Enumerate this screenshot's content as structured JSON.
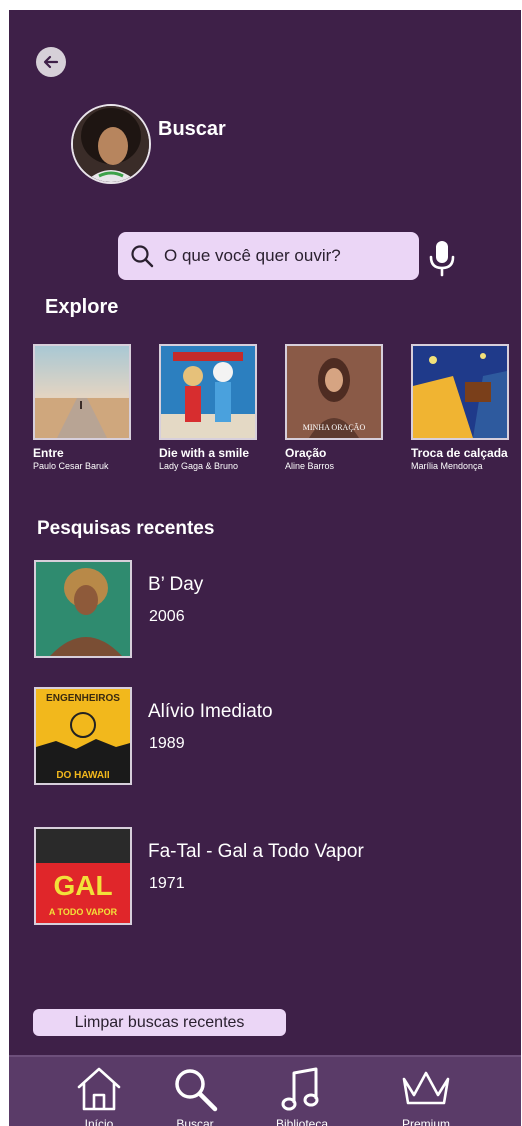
{
  "header": {
    "title": "Buscar"
  },
  "search": {
    "placeholder": "O que você quer ouvir?"
  },
  "explore": {
    "title": "Explore",
    "items": [
      {
        "title": "Entre",
        "artist": "Paulo Cesar Baruk"
      },
      {
        "title": "Die with a smile",
        "artist": "Lady Gaga & Bruno"
      },
      {
        "title": "Oração",
        "artist": "Aline Barros"
      },
      {
        "title": "Troca de calçada",
        "artist": "Marília Mendonça"
      }
    ]
  },
  "recent": {
    "title": "Pesquisas recentes",
    "items": [
      {
        "title": "B’ Day",
        "year": "2006"
      },
      {
        "title": "Alívio Imediato",
        "year": "1989"
      },
      {
        "title": "Fa-Tal - Gal a Todo Vapor",
        "year": "1971"
      }
    ],
    "clear_label": "Limpar buscas recentes"
  },
  "cover_texts": {
    "oracao": "MINHA ORAÇÃO",
    "engenheiros_top": "ENGENHEIROS",
    "engenheiros_bottom": "DO HAWAII",
    "gal_main": "GAL",
    "gal_sub": "A TODO VAPOR"
  },
  "nav": {
    "items": [
      {
        "label": "Início",
        "icon": "home-icon"
      },
      {
        "label": "Buscar",
        "icon": "search-icon"
      },
      {
        "label": "Biblioteca",
        "icon": "music-note-icon"
      },
      {
        "label": "Premium",
        "icon": "crown-icon"
      }
    ]
  },
  "colors": {
    "background": "#3e2048",
    "search_bg": "#ebd6f6",
    "nav_bg": "#5a3b68",
    "text": "#ffffff"
  }
}
